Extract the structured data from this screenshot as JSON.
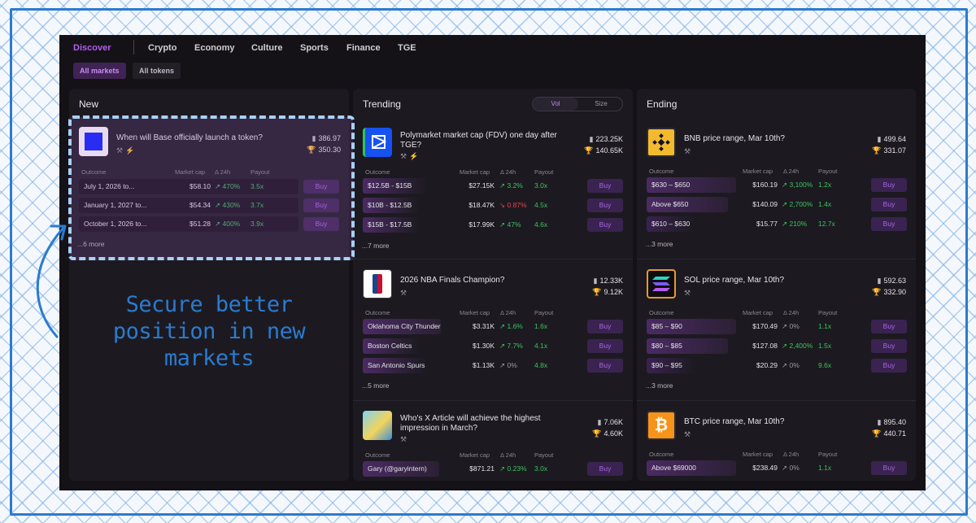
{
  "nav": {
    "items": [
      "Discover",
      "Crypto",
      "Economy",
      "Culture",
      "Sports",
      "Finance",
      "TGE"
    ],
    "active": "Discover",
    "subtabs": [
      "All markets",
      "All tokens"
    ]
  },
  "columns": {
    "new": {
      "title": "New"
    },
    "trending": {
      "title": "Trending",
      "toggle": [
        "Vol",
        "Size"
      ]
    },
    "ending": {
      "title": "Ending"
    }
  },
  "headers": {
    "outcome": "Outcome",
    "market_cap": "Market cap",
    "delta": "Δ 24h",
    "payout": "Payout",
    "buy": "Buy"
  },
  "cards": {
    "base": {
      "title": "When will Base officially launch a token?",
      "vol": "386.97",
      "size": "350.30",
      "rows": [
        {
          "label": "July 1, 2026 to...",
          "cap": "$58.10",
          "chg": "↗ 470%",
          "dir": "up",
          "pay": "3.5x"
        },
        {
          "label": "January 1, 2027 to...",
          "cap": "$54.34",
          "chg": "↗ 430%",
          "dir": "up",
          "pay": "3.7x"
        },
        {
          "label": "October 1, 2026 to...",
          "cap": "$51.28",
          "chg": "↗ 400%",
          "dir": "up",
          "pay": "3.9x"
        }
      ],
      "more": "...6 more"
    },
    "polymarket": {
      "title": "Polymarket market cap (FDV) one day after TGE?",
      "vol": "223.25K",
      "size": "140.65K",
      "rows": [
        {
          "label": "$12.5B - $15B",
          "cap": "$27.15K",
          "chg": "↗ 3.2%",
          "dir": "up",
          "pay": "3.0x"
        },
        {
          "label": "$10B - $12.5B",
          "cap": "$18.47K",
          "chg": "↘ 0.87%",
          "dir": "down",
          "pay": "4.5x"
        },
        {
          "label": "$15B - $17.5B",
          "cap": "$17.99K",
          "chg": "↗ 47%",
          "dir": "up",
          "pay": "4.6x"
        }
      ],
      "more": "...7 more"
    },
    "nba": {
      "title": "2026 NBA Finals Champion?",
      "vol": "12.33K",
      "size": "9.12K",
      "rows": [
        {
          "label": "Oklahoma City Thunder",
          "cap": "$3.31K",
          "chg": "↗ 1.6%",
          "dir": "up",
          "pay": "1.6x"
        },
        {
          "label": "Boston Celtics",
          "cap": "$1.30K",
          "chg": "↗ 7.7%",
          "dir": "up",
          "pay": "4.1x"
        },
        {
          "label": "San Antonio Spurs",
          "cap": "$1.13K",
          "chg": "↗ 0%",
          "dir": "flat",
          "pay": "4.8x"
        }
      ],
      "more": "...5 more"
    },
    "xarticle": {
      "title": "Who's X Article will achieve the highest impression in March?",
      "vol": "7.06K",
      "size": "4.60K",
      "rows": [
        {
          "label": "Gary (@garyintern)",
          "cap": "$871.21",
          "chg": "↗ 0.23%",
          "dir": "up",
          "pay": "3.0x"
        }
      ]
    },
    "bnb": {
      "title": "BNB price range, Mar 10th?",
      "vol": "499.64",
      "size": "331.07",
      "rows": [
        {
          "label": "$630 – $650",
          "cap": "$160.19",
          "chg": "↗ 3,100%",
          "dir": "up",
          "pay": "1.2x"
        },
        {
          "label": "Above $650",
          "cap": "$140.09",
          "chg": "↗ 2,700%",
          "dir": "up",
          "pay": "1.4x"
        },
        {
          "label": "$610 – $630",
          "cap": "$15.77",
          "chg": "↗ 210%",
          "dir": "up",
          "pay": "12.7x"
        }
      ],
      "more": "...3 more"
    },
    "sol": {
      "title": "SOL price range, Mar 10th?",
      "vol": "592.63",
      "size": "332.90",
      "rows": [
        {
          "label": "$85 – $90",
          "cap": "$170.49",
          "chg": "↗ 0%",
          "dir": "flat",
          "pay": "1.1x"
        },
        {
          "label": "$80 – $85",
          "cap": "$127.08",
          "chg": "↗ 2,400%",
          "dir": "up",
          "pay": "1.5x"
        },
        {
          "label": "$90 – $95",
          "cap": "$20.29",
          "chg": "↗ 0%",
          "dir": "flat",
          "pay": "9.6x"
        }
      ],
      "more": "...3 more"
    },
    "btc": {
      "title": "BTC price range, Mar 10th?",
      "vol": "895.40",
      "size": "440.71",
      "rows": [
        {
          "label": "Above $69000",
          "cap": "$238.49",
          "chg": "↗ 0%",
          "dir": "flat",
          "pay": "1.1x"
        }
      ]
    }
  },
  "callout": "Secure better position in new markets",
  "colors": {
    "accent": "#b45cf0",
    "annotation": "#2b7bd0",
    "up": "#3cc25e",
    "down": "#e6434e"
  }
}
